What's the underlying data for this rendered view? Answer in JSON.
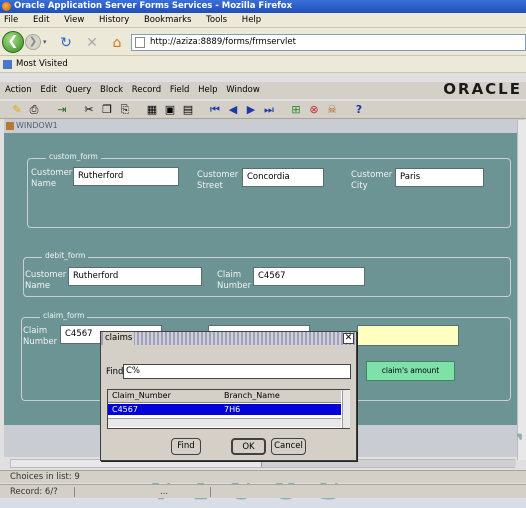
{
  "browser": {
    "title": "Oracle Application Server Forms Services - Mozilla Firefox",
    "menu": [
      "File",
      "Edit",
      "View",
      "History",
      "Bookmarks",
      "Tools",
      "Help"
    ],
    "url": "http://aziza:8889/forms/frmservlet",
    "bookmark": "Most Visited"
  },
  "forms_menu": [
    "Action",
    "Edit",
    "Query",
    "Block",
    "Record",
    "Field",
    "Help",
    "Window"
  ],
  "brand": "ORACLE",
  "window_title": "WINDOW1",
  "custom_form": {
    "title": "custom_form",
    "name_label": "Customer Name",
    "name_value": "Rutherford",
    "street_label": "Customer Street",
    "street_value": "Concordia",
    "city_label": "Customer City",
    "city_value": "Paris"
  },
  "debit_form": {
    "title": "debit_form",
    "name_label": "Customer Name",
    "name_value": "Rutherford",
    "claim_label": "Claim Number",
    "claim_value": "C4567"
  },
  "claim_form": {
    "title": "claim_form",
    "claim_label": "Claim Number",
    "claim_value": "C4567",
    "amount_button": "claim's amount"
  },
  "lov": {
    "title": "claims",
    "find_label": "Find",
    "find_value": "C%",
    "columns": [
      "Claim_Number",
      "Branch_Name"
    ],
    "rows": [
      [
        "C4567",
        "7H6"
      ]
    ],
    "find_button": "Find",
    "ok_button": "OK",
    "cancel_button": "Cancel"
  },
  "status": {
    "choices": "Choices in list: 9",
    "record": "Record: 6/?",
    "ellipsis": "..."
  }
}
